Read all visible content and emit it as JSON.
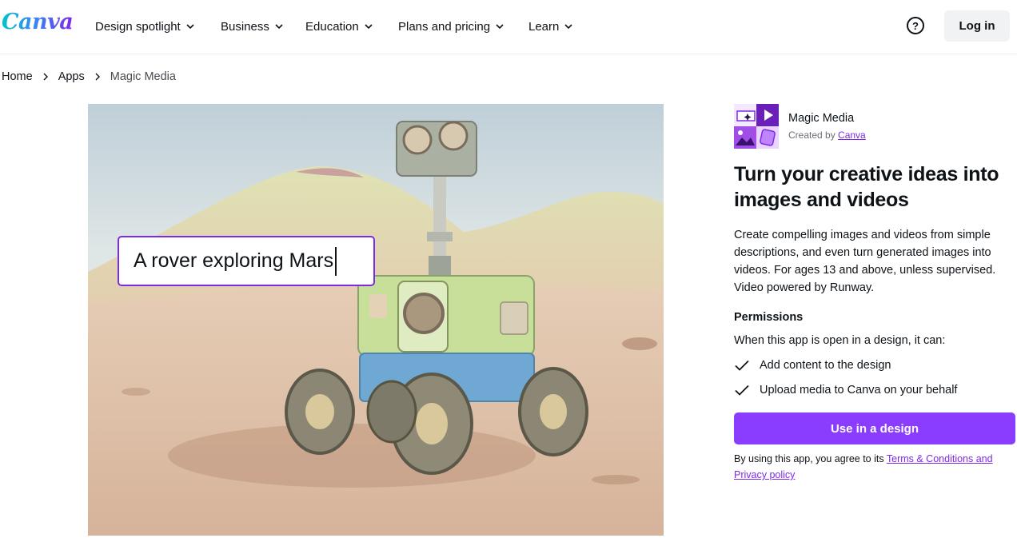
{
  "header": {
    "logo": "Canva",
    "nav": [
      {
        "label": "Design spotlight"
      },
      {
        "label": "Business"
      },
      {
        "label": "Education"
      },
      {
        "label": "Plans and pricing"
      },
      {
        "label": "Learn"
      }
    ],
    "help_icon": "question-circle-icon",
    "login_label": "Log in"
  },
  "breadcrumb": {
    "items": [
      "Home",
      "Apps",
      "Magic Media"
    ]
  },
  "hero": {
    "prompt_text": "A rover exploring Mars"
  },
  "app": {
    "name": "Magic Media",
    "created_by_prefix": "Created by",
    "creator": "Canva",
    "title": "Turn your creative ideas into images and videos",
    "description": "Create compelling images and videos from simple descriptions, and even turn generated images into videos. For ages 13 and above, unless supervised. Video powered by Runway.",
    "permissions_heading": "Permissions",
    "permissions_intro": "When this app is open in a design, it can:",
    "permissions": [
      "Add content to the design",
      "Upload media to Canva on your behalf"
    ],
    "cta_label": "Use in a design",
    "legal_prefix": "By using this app, you agree to its",
    "legal_link": "Terms & Conditions and Privacy policy"
  },
  "colors": {
    "accent": "#8b3dff",
    "link": "#7d2ae8",
    "text": "#0e1318",
    "muted": "#6b6f76",
    "button_bg": "#f1f2f4"
  }
}
